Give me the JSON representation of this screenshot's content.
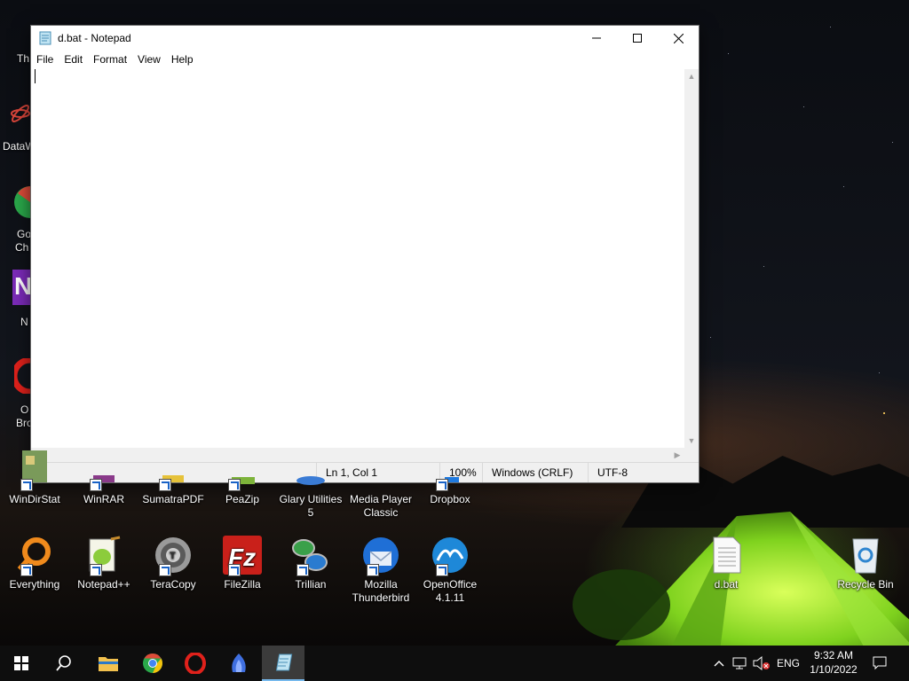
{
  "notepad": {
    "title": "d.bat - Notepad",
    "menu": [
      "File",
      "Edit",
      "Format",
      "View",
      "Help"
    ],
    "content": "",
    "status": {
      "position": "Ln 1, Col 1",
      "zoom": "100%",
      "line_ending": "Windows (CRLF)",
      "encoding": "UTF-8"
    }
  },
  "desktop": {
    "partial_labels": [
      "Th",
      "DataW",
      "Go",
      "Ch",
      "N",
      "O",
      "Bro"
    ],
    "row1": [
      {
        "label": "WinDirStat"
      },
      {
        "label": "WinRAR"
      },
      {
        "label": "SumatraPDF"
      },
      {
        "label": "PeaZip"
      },
      {
        "label": "Glary Utilities 5"
      },
      {
        "label": "Media Player Classic"
      },
      {
        "label": "Dropbox"
      }
    ],
    "row2": [
      {
        "label": "Everything"
      },
      {
        "label": "Notepad++"
      },
      {
        "label": "TeraCopy"
      },
      {
        "label": "FileZilla"
      },
      {
        "label": "Trillian"
      },
      {
        "label": "Mozilla Thunderbird"
      },
      {
        "label": "OpenOffice 4.1.11"
      }
    ],
    "right": [
      {
        "label": "d.bat"
      },
      {
        "label": "Recycle Bin"
      }
    ]
  },
  "taskbar": {
    "language": "ENG",
    "time": "9:32 AM",
    "date": "1/10/2022"
  },
  "colors": {
    "accent": "#76b9ed",
    "taskbar_bg": "#0e0e0e"
  }
}
